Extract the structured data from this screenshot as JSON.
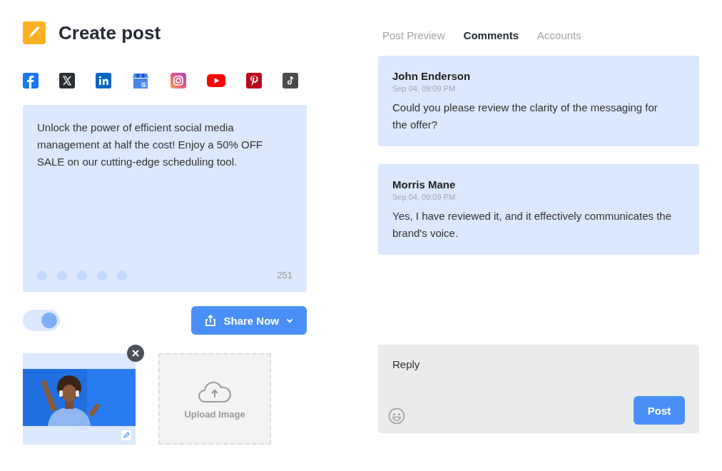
{
  "header": {
    "title": "Create post"
  },
  "platforms": [
    {
      "kind": "facebook"
    },
    {
      "kind": "x"
    },
    {
      "kind": "linkedin"
    },
    {
      "kind": "business"
    },
    {
      "kind": "instagram"
    },
    {
      "kind": "youtube"
    },
    {
      "kind": "pinterest"
    },
    {
      "kind": "tiktok"
    }
  ],
  "editor": {
    "text": "Unlock the power of efficient social media management at half the cost!  Enjoy a 50% OFF SALE on our cutting-edge scheduling tool.",
    "count": "251"
  },
  "toggle": {
    "on": true
  },
  "share_button": {
    "label": "Share Now"
  },
  "media": [
    {
      "kind": "picture"
    },
    {
      "kind": "upload",
      "label": "Upload Image"
    }
  ],
  "tabs": [
    {
      "label": "Post Preview",
      "selected": false
    },
    {
      "label": "Comments",
      "selected": true
    },
    {
      "label": "Accounts",
      "selected": false
    }
  ],
  "comments": [
    {
      "author": "John Enderson",
      "time": "Sep 04, 09:09 PM",
      "text": "Could you please review the clarity of the messaging for the offer?"
    },
    {
      "author": "Morris Mane",
      "time": "Sep 04, 09:09 PM",
      "text": "Yes, I have reviewed it, and it effectively communicates the brand's voice."
    }
  ],
  "reply": {
    "placeholder": "Reply",
    "button": "Post"
  }
}
